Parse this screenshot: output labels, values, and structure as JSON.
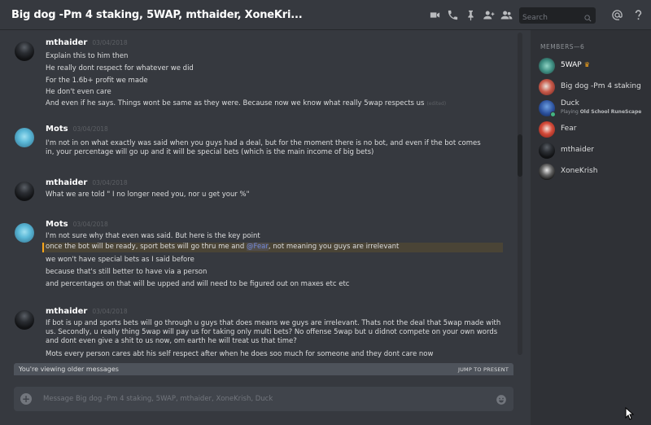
{
  "header": {
    "title": "Big dog -Pm 4 staking, 5WAP, mthaider, XoneKri...",
    "search_placeholder": "Search",
    "icons": [
      "video-call-icon",
      "voice-call-icon",
      "pin-icon",
      "add-member-icon",
      "member-list-icon",
      "search-icon",
      "mention-icon",
      "help-icon"
    ]
  },
  "messages": [
    {
      "author": "mthaider",
      "timestamp": "03/04/2018",
      "lines": [
        "Explain this to him then",
        "He really dont respect for whatever we did",
        "For the 1.6b+ profit we made",
        "He don't even care",
        "And even if he says. Things wont be same as they were. Because now we know what really 5wap respects us"
      ],
      "edited": "(edited)"
    },
    {
      "author": "Mots",
      "timestamp": "03/04/2018",
      "lines": [
        "I'm not in on what exactly was said when you guys had a deal, but for the moment there is no bot, and even if the bot comes in, your percentage will go up and it will be special bets (which is the main income of big bets)"
      ]
    },
    {
      "author": "mthaider",
      "timestamp": "03/04/2018",
      "lines": [
        "What we are told \" I no longer need you, nor u get your %\""
      ]
    },
    {
      "author": "Mots",
      "timestamp": "03/04/2018",
      "lines": [
        "I'm not sure why that even was said. But here is the key point",
        "once the bot will be ready, sport bets will go thru me and",
        "we won't have special bets as I said before",
        "because that's still better to have via a person",
        "and percentages on that will be upped and will need to be figured out on maxes etc etc"
      ],
      "mention": "@Fear",
      "mention_after": ", not meaning you guys are irrelevant"
    },
    {
      "author": "mthaider",
      "timestamp": "03/04/2018",
      "lines": [
        "If bot is up and sports bets will go through u guys that does means we guys are irrelevant. Thats not the deal that 5wap made with us. Secondly, u really thing 5wap will pay us for taking only multi bets? No offense 5wap but u didnot compete on your own words and dont even give a shit to us now, om earth he will treat us that time?",
        "Mots every person cares abt his self respect after when he does soo much for someone and they dont care now"
      ]
    }
  ],
  "older_bar": {
    "text": "You're viewing older messages",
    "jump": "JUMP TO PRESENT"
  },
  "composer": {
    "placeholder": "Message Big dog -Pm 4 staking, 5WAP, mthaider, XoneKrish, Duck"
  },
  "members": {
    "header": "MEMBERS—6",
    "list": [
      {
        "name": "5WAP",
        "crown": "♛"
      },
      {
        "name": "Big dog -Pm 4 staking"
      },
      {
        "name": "Duck",
        "status_prefix": "Playing ",
        "status_game": "Old School RuneScape"
      },
      {
        "name": "Fear"
      },
      {
        "name": "mthaider"
      },
      {
        "name": "XoneKrish"
      }
    ]
  },
  "colors": {
    "background": "#36393f",
    "sidebar": "#2f3136",
    "mention_highlight": "#faa61a",
    "online": "#43b581",
    "crown": "#faa61a"
  }
}
